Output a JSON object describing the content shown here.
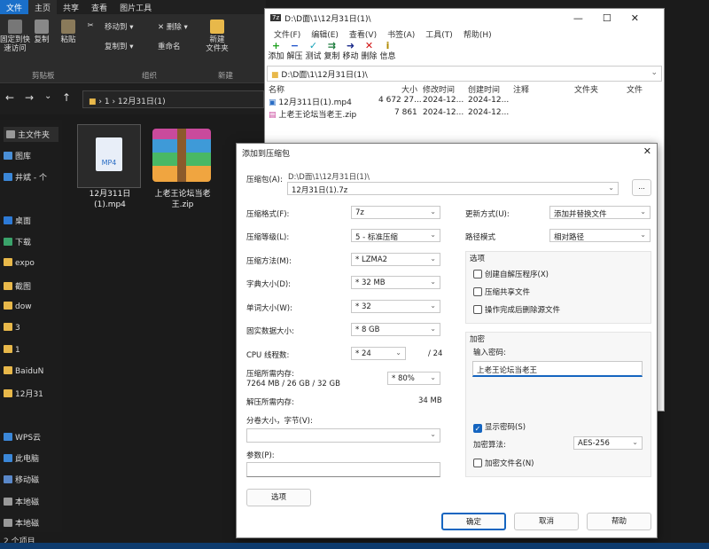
{
  "explorer": {
    "tabs": [
      "文件",
      "主页",
      "共享",
      "查看",
      "图片工具"
    ],
    "ribbon": {
      "pin_label": "固定到快\n速访问",
      "copy": "复制",
      "paste": "粘贴",
      "move_to": "移动到",
      "copy_to": "复制到",
      "delete": "删除",
      "rename": "重命名",
      "new_folder": "新建\n文件夹",
      "group_clipboard": "剪贴板",
      "group_organize": "组织",
      "group_new": "新建"
    },
    "path": "1  ›  12月31日(1)",
    "path_prefix": "›",
    "nav_items": [
      "主文件夹",
      "图库",
      "井斌 - 个",
      "桌面",
      "下载",
      "expo",
      "截图",
      "dow",
      "3",
      "1",
      "BaiduN",
      "12月31",
      "WPS云",
      "此电脑",
      "移动磁",
      "本地磁",
      "本地磁"
    ],
    "files": [
      {
        "name": "12月311日\n(1).mp4",
        "type": "MP4"
      },
      {
        "name": "上老王论坛当老\n王.zip",
        "type": "ZIP"
      }
    ],
    "status": "2 个项目"
  },
  "fm": {
    "title": "D:\\D面\\1\\12月31日(1)\\",
    "menu": [
      "文件(F)",
      "编辑(E)",
      "查看(V)",
      "书签(A)",
      "工具(T)",
      "帮助(H)"
    ],
    "tools": [
      {
        "icon": "+",
        "label": "添加"
      },
      {
        "icon": "−",
        "label": "解压"
      },
      {
        "icon": "✓",
        "label": "测试"
      },
      {
        "icon": "⇉",
        "label": "复制"
      },
      {
        "icon": "➜",
        "label": "移动"
      },
      {
        "icon": "✕",
        "label": "删除"
      },
      {
        "icon": "i",
        "label": "信息"
      }
    ],
    "path": "D:\\D面\\1\\12月31日(1)\\",
    "headers": [
      "名称",
      "大小",
      "修改时间",
      "创建时间",
      "注释",
      "文件夹",
      "文件"
    ],
    "rows": [
      {
        "name": "12月311日(1).mp4",
        "size": "4 672 27...",
        "mtime": "2024-12...",
        "ctime": "2024-12..."
      },
      {
        "name": "上老王论坛当老王.zip",
        "size": "7 861",
        "mtime": "2024-12...",
        "ctime": "2024-12..."
      }
    ]
  },
  "dialog": {
    "title": "添加到压缩包",
    "archive_label": "压缩包(A):",
    "archive_dir": "D:\\D面\\1\\12月31日(1)\\",
    "archive_name": "12月31日(1).7z",
    "browse": "...",
    "format_label": "压缩格式(F):",
    "format": "7z",
    "level_label": "压缩等级(L):",
    "level": "5 - 标准压缩",
    "method_label": "压缩方法(M):",
    "method": "* LZMA2",
    "dict_label": "字典大小(D):",
    "dict": "* 32 MB",
    "word_label": "单词大小(W):",
    "word": "* 32",
    "solid_label": "固实数据大小:",
    "solid": "* 8 GB",
    "threads_label": "CPU 线程数:",
    "threads": "* 24",
    "threads_max": "/ 24",
    "mem_label": "压缩所需内存:",
    "mem_value": "7264 MB / 26 GB / 32 GB",
    "mem_pct": "* 80%",
    "demem_label": "解压所需内存:",
    "demem_value": "34 MB",
    "split_label": "分卷大小，字节(V):",
    "params_label": "参数(P):",
    "options_button": "选项",
    "update_label": "更新方式(U):",
    "update": "添加并替换文件",
    "pathmode_label": "路径模式",
    "pathmode": "相对路径",
    "options_group": "选项",
    "opt_sfx": "创建自解压程序(X)",
    "opt_shared": "压缩共享文件",
    "opt_delete": "操作完成后删除源文件",
    "enc_group": "加密",
    "pwd_label": "输入密码:",
    "password": "上老王论坛当老王",
    "show_pwd": "显示密码(S)",
    "enc_method_label": "加密算法:",
    "enc_method": "AES-256",
    "enc_names": "加密文件名(N)",
    "ok": "确定",
    "cancel": "取消",
    "help": "帮助"
  }
}
